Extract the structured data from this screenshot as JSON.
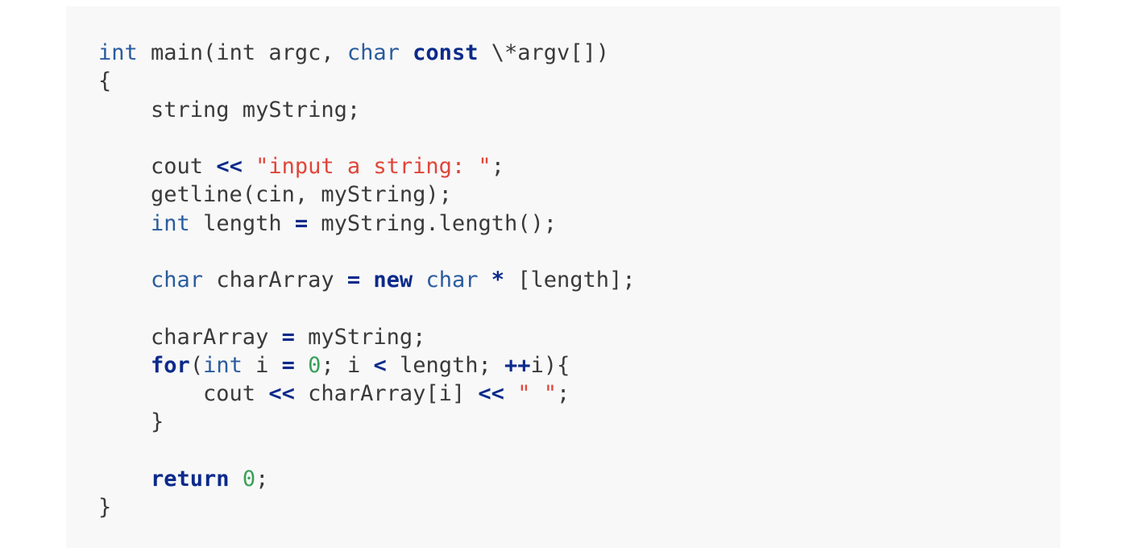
{
  "colors": {
    "background": "#f8f8f8",
    "plain": "#3a3a3a",
    "type": "#2a5c9e",
    "keyword": "#0b2a8a",
    "string": "#e0453a",
    "number": "#3aa05a"
  },
  "code": {
    "language": "C++",
    "lines": [
      [
        [
          "type",
          "int"
        ],
        [
          "plain",
          " main(int argc, "
        ],
        [
          "type",
          "char"
        ],
        [
          "plain",
          " "
        ],
        [
          "kw",
          "const"
        ],
        [
          "plain",
          " \\*argv[])"
        ]
      ],
      [
        [
          "plain",
          "{"
        ]
      ],
      [
        [
          "plain",
          "    string myString;"
        ]
      ],
      [],
      [
        [
          "plain",
          "    cout "
        ],
        [
          "op",
          "<<"
        ],
        [
          "plain",
          " "
        ],
        [
          "str",
          "\"input a string: \""
        ],
        [
          "plain",
          ";"
        ]
      ],
      [
        [
          "plain",
          "    getline(cin, myString);"
        ]
      ],
      [
        [
          "plain",
          "    "
        ],
        [
          "type",
          "int"
        ],
        [
          "plain",
          " length "
        ],
        [
          "op",
          "="
        ],
        [
          "plain",
          " myString.length();"
        ]
      ],
      [],
      [
        [
          "plain",
          "    "
        ],
        [
          "type",
          "char"
        ],
        [
          "plain",
          " charArray "
        ],
        [
          "op",
          "="
        ],
        [
          "plain",
          " "
        ],
        [
          "kw",
          "new"
        ],
        [
          "plain",
          " "
        ],
        [
          "type",
          "char"
        ],
        [
          "plain",
          " "
        ],
        [
          "op",
          "*"
        ],
        [
          "plain",
          " [length];"
        ]
      ],
      [],
      [
        [
          "plain",
          "    charArray "
        ],
        [
          "op",
          "="
        ],
        [
          "plain",
          " myString;"
        ]
      ],
      [
        [
          "plain",
          "    "
        ],
        [
          "kw",
          "for"
        ],
        [
          "plain",
          "("
        ],
        [
          "type",
          "int"
        ],
        [
          "plain",
          " i "
        ],
        [
          "op",
          "="
        ],
        [
          "plain",
          " "
        ],
        [
          "num",
          "0"
        ],
        [
          "plain",
          "; i "
        ],
        [
          "op",
          "<"
        ],
        [
          "plain",
          " length; "
        ],
        [
          "op",
          "++"
        ],
        [
          "plain",
          "i){"
        ]
      ],
      [
        [
          "plain",
          "        cout "
        ],
        [
          "op",
          "<<"
        ],
        [
          "plain",
          " charArray[i] "
        ],
        [
          "op",
          "<<"
        ],
        [
          "plain",
          " "
        ],
        [
          "str",
          "\" \""
        ],
        [
          "plain",
          ";"
        ]
      ],
      [
        [
          "plain",
          "    }"
        ]
      ],
      [],
      [
        [
          "plain",
          "    "
        ],
        [
          "kw",
          "return"
        ],
        [
          "plain",
          " "
        ],
        [
          "num",
          "0"
        ],
        [
          "plain",
          ";"
        ]
      ],
      [
        [
          "plain",
          "}"
        ]
      ]
    ]
  }
}
